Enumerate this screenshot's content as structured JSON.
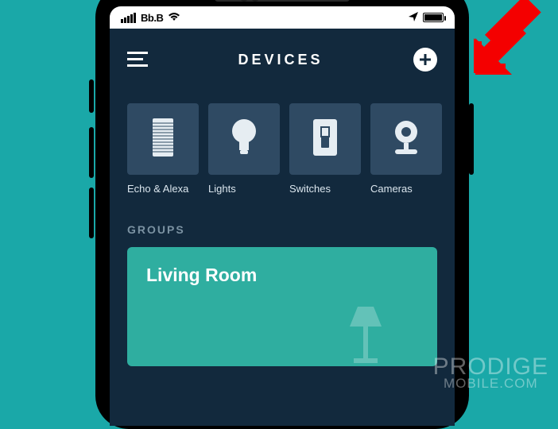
{
  "status": {
    "carrier": "Bb.B"
  },
  "header": {
    "title": "DEVICES"
  },
  "categories": [
    {
      "icon": "echo-icon",
      "label": "Echo & Alexa"
    },
    {
      "icon": "bulb-icon",
      "label": "Lights"
    },
    {
      "icon": "switch-icon",
      "label": "Switches"
    },
    {
      "icon": "camera-icon",
      "label": "Cameras"
    }
  ],
  "sections": {
    "groups_label": "GROUPS"
  },
  "groups": [
    {
      "name": "Living Room"
    }
  ],
  "watermark": {
    "line1": "PRODIGE",
    "line2": "MOBILE.COM"
  }
}
